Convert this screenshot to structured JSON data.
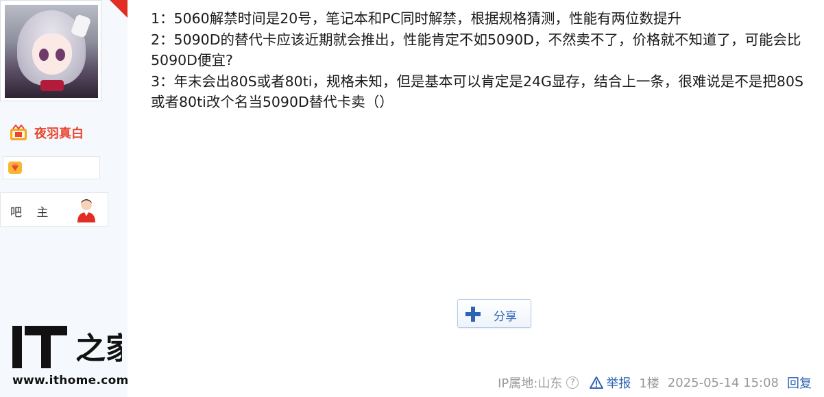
{
  "user": {
    "username": "夜羽真白",
    "role": "吧 主"
  },
  "post": {
    "lines": [
      "1：5060解禁时间是20号，笔记本和PC同时解禁，根据规格猜测，性能有两位数提升",
      "2：5090D的替代卡应该近期就会推出，性能肯定不如5090D，不然卖不了，价格就不知道了，可能会比5090D便宜?",
      "3：年末会出80S或者80ti，规格未知，但是基本可以肯定是24G显存，结合上一条，很难说是不是把80S或者80ti改个名当5090D替代卡卖（）"
    ]
  },
  "share": {
    "label": "分享"
  },
  "footer": {
    "ip": "IP属地:山东",
    "report": "举报",
    "floor": "1楼",
    "time": "2025-05-14 15:08",
    "reply": "回复"
  },
  "watermark": {
    "logo_text": "IT之家",
    "url": "www.ithome.com"
  },
  "colors": {
    "username": "#e8452f",
    "link": "#2d64b3",
    "meta": "#999999",
    "sidebar_bg": "#f5f8fc"
  }
}
